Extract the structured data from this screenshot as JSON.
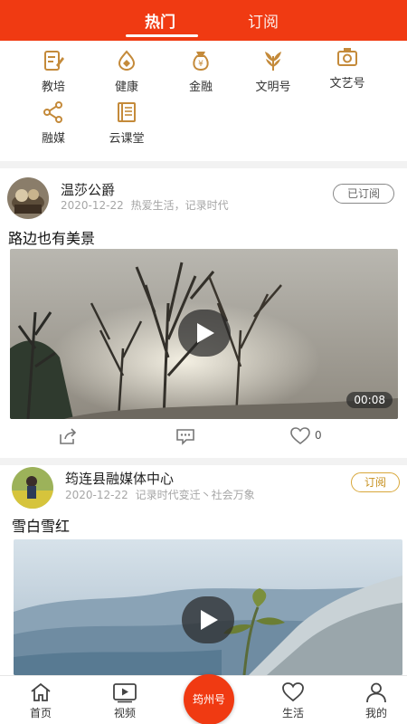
{
  "top_tabs": {
    "hot": "热门",
    "subscribe": "订阅"
  },
  "categories": [
    {
      "label": "教培",
      "icon": "edit-doc-icon"
    },
    {
      "label": "健康",
      "icon": "health-icon"
    },
    {
      "label": "金融",
      "icon": "money-bag-icon"
    },
    {
      "label": "文明号",
      "icon": "wheat-icon"
    },
    {
      "label": "文艺号",
      "icon": "camera-icon"
    },
    {
      "label": "融媒",
      "icon": "share-icon"
    },
    {
      "label": "云课堂",
      "icon": "book-icon"
    }
  ],
  "posts": [
    {
      "author": "温莎公爵",
      "date": "2020-12-22",
      "tags": "热爱生活，记录时代",
      "subscribe_label": "已订阅",
      "title": "路边也有美景",
      "duration": "00:08",
      "likes": "0"
    },
    {
      "author": "筠连县融媒体中心",
      "date": "2020-12-22",
      "tags": "记录时代变迁丶社会万象",
      "subscribe_label": "订阅",
      "title": "雪白雪红"
    }
  ],
  "bottom_nav": {
    "home": "首页",
    "video": "视频",
    "center": "筠州号",
    "life": "生活",
    "mine": "我的"
  },
  "colors": {
    "brand": "#f03a12",
    "icon_gold": "#c48a3a",
    "subscribe_gold": "#d8a73a"
  }
}
